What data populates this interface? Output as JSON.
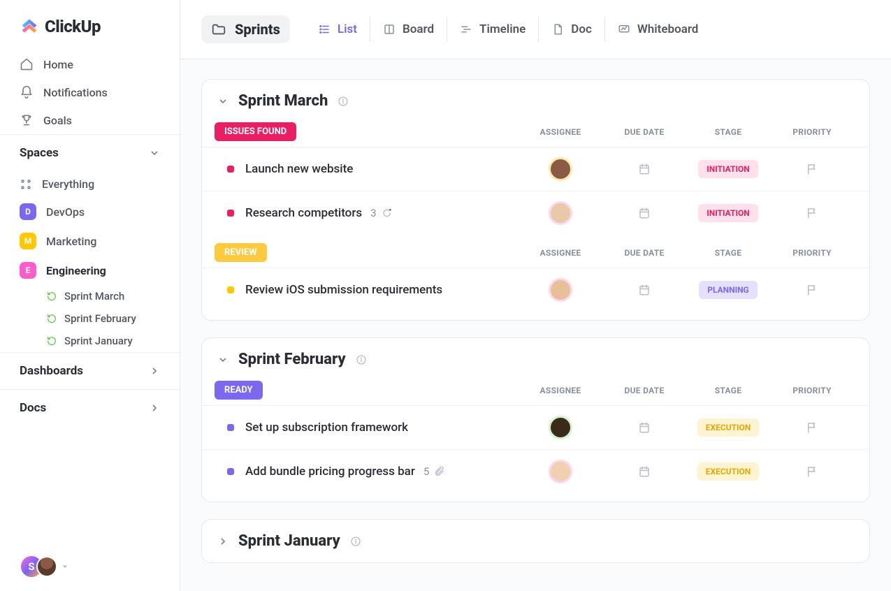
{
  "brand": {
    "name": "ClickUp"
  },
  "nav": [
    {
      "label": "Home",
      "icon": "home-icon"
    },
    {
      "label": "Notifications",
      "icon": "bell-icon"
    },
    {
      "label": "Goals",
      "icon": "trophy-icon"
    }
  ],
  "sections": {
    "spaces": "Spaces",
    "dashboards": "Dashboards",
    "docs": "Docs"
  },
  "everything": "Everything",
  "spaces": [
    {
      "label": "DevOps",
      "badge": "D",
      "color": "#7b68ee",
      "active": false
    },
    {
      "label": "Marketing",
      "badge": "M",
      "color": "#ffc800",
      "active": false
    },
    {
      "label": "Engineering",
      "badge": "E",
      "color": "#ff5ccb",
      "active": true
    }
  ],
  "sprint_nav": [
    {
      "label": "Sprint  March"
    },
    {
      "label": "Sprint  February"
    },
    {
      "label": "Sprint January"
    }
  ],
  "folder_title": "Sprints",
  "views": [
    {
      "label": "List",
      "icon": "list-icon",
      "active": true
    },
    {
      "label": "Board",
      "icon": "board-icon",
      "active": false
    },
    {
      "label": "Timeline",
      "icon": "timeline-icon",
      "active": false
    },
    {
      "label": "Doc",
      "icon": "doc-icon",
      "active": false
    },
    {
      "label": "Whiteboard",
      "icon": "whiteboard-icon",
      "active": false
    }
  ],
  "columns": {
    "assignee": "ASSIGNEE",
    "due": "DUE DATE",
    "stage": "STAGE",
    "priority": "PRIORITY"
  },
  "colors": {
    "issues_found_bg": "#e91e63",
    "issues_found_text": "#ffffff",
    "review_bg": "#ffc940",
    "review_text": "#ffffff",
    "ready_bg": "#7b68ee",
    "ready_text": "#ffffff",
    "initiation_bg": "#ffe0eb",
    "initiation_text": "#e91e63",
    "planning_bg": "#e5e1fc",
    "planning_text": "#7b68ee",
    "execution_bg": "#fff4d1",
    "execution_text": "#e6a700",
    "task_dot_pink": "#e91e63",
    "task_dot_amber": "#ffc800",
    "task_dot_purple": "#7b68ee",
    "avatar_ring_yellow": "#ffe9a8",
    "avatar_ring_pink": "#ffd6ef",
    "avatar_ring_green": "#d0f5c7"
  },
  "sprints": [
    {
      "title": "Sprint March",
      "expanded": true,
      "groups": [
        {
          "status": "ISSUES FOUND",
          "status_bg_key": "issues_found_bg",
          "status_fg_key": "issues_found_text",
          "tasks": [
            {
              "title": "Launch new website",
              "dot_color_key": "task_dot_pink",
              "avatar_bg": "#8a5a44",
              "avatar_ring_key": "avatar_ring_yellow",
              "stage": "INITIATION",
              "stage_bg_key": "initiation_bg",
              "stage_fg_key": "initiation_text"
            },
            {
              "title": "Research competitors",
              "dot_color_key": "task_dot_pink",
              "sub_count": "3",
              "sub_icon": "chat-icon",
              "avatar_bg": "#e8c9a8",
              "avatar_ring_key": "avatar_ring_pink",
              "stage": "INITIATION",
              "stage_bg_key": "initiation_bg",
              "stage_fg_key": "initiation_text"
            }
          ]
        },
        {
          "status": "REVIEW",
          "status_bg_key": "review_bg",
          "status_fg_key": "review_text",
          "tasks": [
            {
              "title": "Review iOS submission requirements",
              "dot_color_key": "task_dot_amber",
              "avatar_bg": "#e8c097",
              "avatar_ring_key": "avatar_ring_pink",
              "stage": "PLANNING",
              "stage_bg_key": "planning_bg",
              "stage_fg_key": "planning_text"
            }
          ]
        }
      ]
    },
    {
      "title": "Sprint February",
      "expanded": true,
      "groups": [
        {
          "status": "READY",
          "status_bg_key": "ready_bg",
          "status_fg_key": "ready_text",
          "tasks": [
            {
              "title": "Set up subscription framework",
              "dot_color_key": "task_dot_purple",
              "avatar_bg": "#3a2a1a",
              "avatar_ring_key": "avatar_ring_green",
              "stage": "EXECUTION",
              "stage_bg_key": "execution_bg",
              "stage_fg_key": "execution_text"
            },
            {
              "title": "Add bundle pricing progress bar",
              "dot_color_key": "task_dot_purple",
              "sub_count": "5",
              "sub_icon": "paperclip-icon",
              "avatar_bg": "#f0d0b0",
              "avatar_ring_key": "avatar_ring_pink",
              "stage": "EXECUTION",
              "stage_bg_key": "execution_bg",
              "stage_fg_key": "execution_text"
            }
          ]
        }
      ]
    },
    {
      "title": "Sprint January",
      "expanded": false,
      "groups": []
    }
  ],
  "user_badge": "S"
}
